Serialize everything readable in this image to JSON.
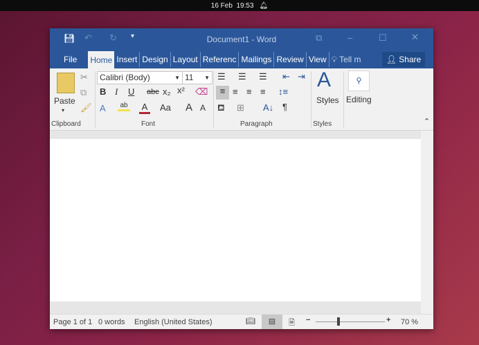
{
  "system": {
    "date": "16 Feb",
    "time": "19:53"
  },
  "window": {
    "title": "Document1 - Word"
  },
  "tabs": [
    "File",
    "Home",
    "Insert",
    "Design",
    "Layout",
    "Referenc",
    "Mailings",
    "Review",
    "View"
  ],
  "tell_me": "Tell m",
  "share": "Share",
  "ribbon": {
    "paste": "Paste",
    "font_name": "Calibri (Body)",
    "font_size": "11",
    "styles": "Styles",
    "editing": "Editing",
    "groups": {
      "clipboard": "Clipboard",
      "font": "Font",
      "paragraph": "Paragraph",
      "styles": "Styles"
    },
    "bold": "B",
    "italic": "I",
    "underline": "U",
    "strike": "abc",
    "sub": "x₂",
    "sup": "x²",
    "case": "Aa",
    "grow": "A",
    "shrink": "A",
    "pilcrow": "¶"
  },
  "status": {
    "page": "Page 1 of 1",
    "words": "0 words",
    "language": "English (United States)",
    "zoom": "70 %",
    "zoom_percent": 70
  },
  "colors": {
    "word_blue": "#2b579a"
  }
}
